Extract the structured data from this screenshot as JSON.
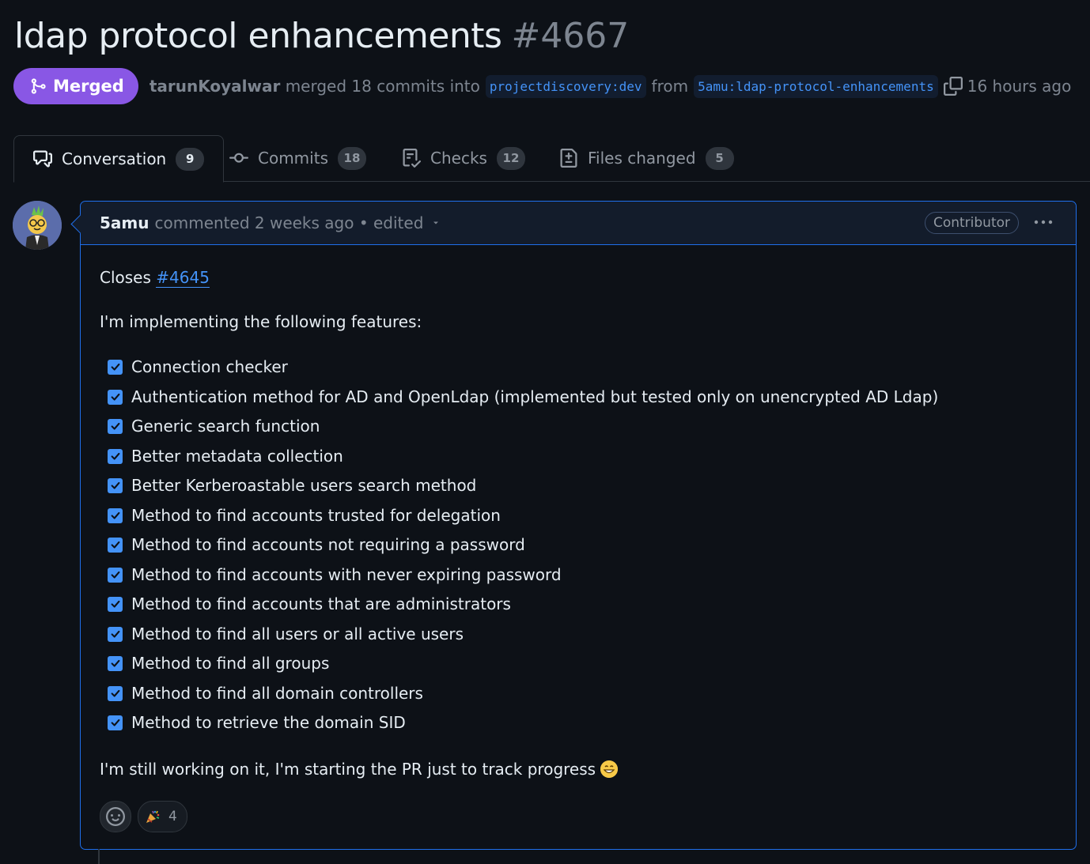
{
  "pr": {
    "title": "ldap protocol enhancements",
    "number": "#4667",
    "state": "Merged",
    "author": "tarunKoyalwar",
    "merged_text": "merged 18 commits into",
    "base_branch": "projectdiscovery:dev",
    "from_text": "from",
    "head_branch": "5amu:ldap-protocol-enhancements",
    "time": "16 hours ago"
  },
  "tabs": [
    {
      "label": "Conversation",
      "count": "9",
      "icon": "comment-discussion-icon",
      "active": true
    },
    {
      "label": "Commits",
      "count": "18",
      "icon": "git-commit-icon"
    },
    {
      "label": "Checks",
      "count": "12",
      "icon": "checklist-icon"
    },
    {
      "label": "Files changed",
      "count": "5",
      "icon": "file-diff-icon"
    }
  ],
  "comment": {
    "author": "5amu",
    "meta": "commented 2 weeks ago • edited",
    "role_badge": "Contributor",
    "closes_label": "Closes",
    "closes_issue": "#4645",
    "intro": "I'm implementing the following features:",
    "tasks": [
      "Connection checker",
      "Authentication method for AD and OpenLdap (implemented but tested only on unencrypted AD Ldap)",
      "Generic search function",
      "Better metadata collection",
      "Better Kerberoastable users search method",
      "Method to find accounts trusted for delegation",
      "Method to find accounts not requiring a password",
      "Method to find accounts with never expiring password",
      "Method to find accounts that are administrators",
      "Method to find all users or all active users",
      "Method to find all groups",
      "Method to find all domain controllers",
      "Method to retrieve the domain SID"
    ],
    "outro": "I'm still working on it, I'm starting the PR just to track progress",
    "reactions": [
      {
        "emoji": "tada-icon",
        "count": "4"
      }
    ]
  },
  "colors": {
    "merged": "#8957e5",
    "accent": "#4493f8",
    "bg": "#0d1117"
  }
}
